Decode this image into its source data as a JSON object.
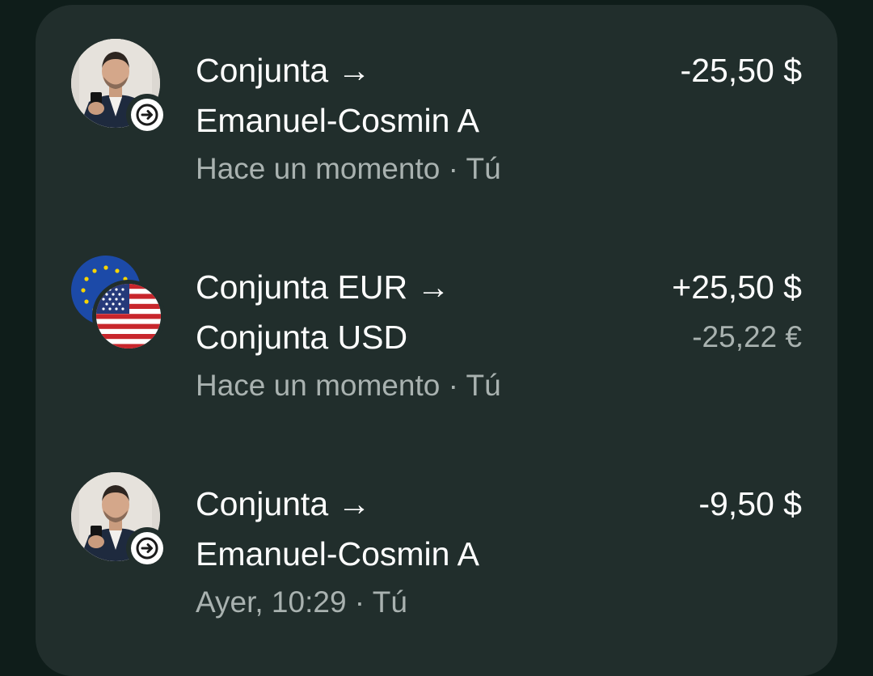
{
  "transactions": [
    {
      "title_line1": "Conjunta →",
      "title_line2": "Emanuel-Cosmin A",
      "meta": "Hace un momento · Tú",
      "amount": "-25,50 $",
      "icon": "person-avatar-with-arrow-icon"
    },
    {
      "title_line1": "Conjunta EUR →",
      "title_line2": "Conjunta USD",
      "meta": "Hace un momento · Tú",
      "amount": "+25,50 $",
      "amount_secondary": "-25,22 €",
      "icon": "eu-us-flags-icon"
    },
    {
      "title_line1": "Conjunta →",
      "title_line2": "Emanuel-Cosmin A",
      "meta": "Ayer, 10:29 · Tú",
      "amount": "-9,50 $",
      "icon": "person-avatar-with-arrow-icon"
    }
  ],
  "colors": {
    "background": "#0f1d1a",
    "card": "#212e2c",
    "text_primary": "#ffffff",
    "text_secondary": "#a9b2b0"
  }
}
